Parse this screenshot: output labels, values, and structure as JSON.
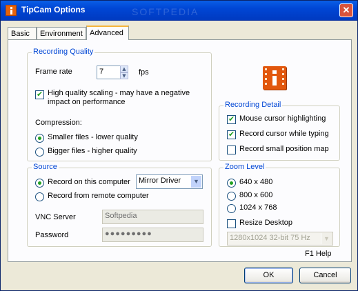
{
  "window": {
    "title": "TipCam Options",
    "close_label": "✕"
  },
  "watermark": "SOFTPEDIA",
  "tabs": [
    {
      "label": "Basic",
      "active": false
    },
    {
      "label": "Environment",
      "active": false
    },
    {
      "label": "Advanced",
      "active": true
    }
  ],
  "recording_quality": {
    "legend": "Recording Quality",
    "frame_rate_label": "Frame rate",
    "frame_rate_value": "7",
    "fps_label": "fps",
    "high_quality_label_1": "High quality scaling - may have a negative",
    "high_quality_label_2": "impact on performance",
    "high_quality_checked": true,
    "compression_label": "Compression:",
    "compression_options": [
      {
        "label": "Smaller files - lower quality",
        "checked": true
      },
      {
        "label": "Bigger files - higher quality",
        "checked": false
      }
    ]
  },
  "source": {
    "legend": "Source",
    "options": [
      {
        "label": "Record on this computer",
        "checked": true
      },
      {
        "label": "Record from remote computer",
        "checked": false
      }
    ],
    "driver_value": "Mirror Driver",
    "vnc_server_label": "VNC Server",
    "vnc_server_value": "Softpedia",
    "password_label": "Password",
    "password_value": "●●●●●●●●●"
  },
  "recording_detail": {
    "legend": "Recording Detail",
    "items": [
      {
        "label": "Mouse cursor highlighting",
        "checked": true
      },
      {
        "label": "Record cursor while typing",
        "checked": true
      },
      {
        "label": "Record small position map",
        "checked": false
      }
    ]
  },
  "zoom_level": {
    "legend": "Zoom Level",
    "options": [
      {
        "label": "640 x 480",
        "checked": true
      },
      {
        "label": "800 x 600",
        "checked": false
      },
      {
        "label": "1024 x 768",
        "checked": false
      }
    ],
    "resize_label": "Resize Desktop",
    "resize_checked": false,
    "mode_value": "1280x1024 32-bit 75 Hz"
  },
  "help_label": "F1  Help",
  "buttons": {
    "ok": "OK",
    "cancel": "Cancel"
  },
  "icons": {
    "app": "tipcam-icon",
    "logo": "tipcam-logo-icon",
    "check": "✔"
  },
  "colors": {
    "titlebar": "#0046d5",
    "legend": "#0046d5",
    "check": "#21a121",
    "brand": "#e2570d"
  }
}
